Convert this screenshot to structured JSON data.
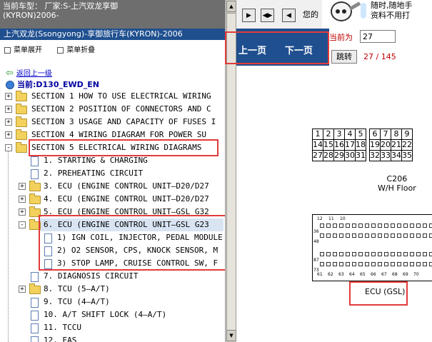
{
  "header": {
    "vehicle_label": "当前车型：",
    "vehicle_maker": "厂家:S-上汽双龙享御",
    "vehicle_code": "(KYRON)2006-",
    "subtitle": "上汽双龙(Ssongyong)-享御旅行车(KYRON)-2006"
  },
  "menu_controls": {
    "expand": "菜单展开",
    "collapse": "菜单折叠"
  },
  "back_link": "返回上一级",
  "current_node": "当前:D130_EWD_EN",
  "tree": [
    {
      "label": "SECTION 1 HOW TO USE ELECTRICAL WIRING",
      "kind": "folder",
      "pm": "+"
    },
    {
      "label": "SECTION 2 POSITION OF CONNECTORS AND C",
      "kind": "folder",
      "pm": "+"
    },
    {
      "label": "SECTION 3 USAGE AND CAPACITY OF FUSES I",
      "kind": "folder",
      "pm": "+"
    },
    {
      "label": "SECTION 4 WIRING DIAGRAM FOR POWER SU",
      "kind": "folder",
      "pm": "+"
    },
    {
      "label": "SECTION 5 ELECTRICAL WIRING DIAGRAMS",
      "kind": "folder",
      "pm": "-"
    },
    {
      "label": "1. STARTING & CHARGING",
      "kind": "doc"
    },
    {
      "label": "2. PREHEATING CIRCUIT",
      "kind": "doc"
    },
    {
      "label": "3. ECU (ENGINE CONTROL UNIT—D20/D27",
      "kind": "folder",
      "pm": "+"
    },
    {
      "label": "4. ECU (ENGINE CONTROL UNIT—D20/D27",
      "kind": "folder",
      "pm": "+"
    },
    {
      "label": "5. ECU (ENGINE CONTROL UNIT—GSL G32",
      "kind": "folder",
      "pm": "+"
    },
    {
      "label": "6. ECU (ENGINE CONTROL UNIT—GSL G23",
      "kind": "folder",
      "pm": "-"
    },
    {
      "label": "1) IGN COIL, INJECTOR, PEDAL MODULE",
      "kind": "doc"
    },
    {
      "label": "2) O2 SENSOR, CPS, KNOCK SENSOR, M",
      "kind": "doc"
    },
    {
      "label": "3) STOP LAMP, CRUISE CONTROL SW, F",
      "kind": "doc"
    },
    {
      "label": "7. DIAGNOSIS CIRCUIT",
      "kind": "doc"
    },
    {
      "label": "8. TCU (5—A/T)",
      "kind": "folder",
      "pm": "+"
    },
    {
      "label": "9. TCU (4—A/T)",
      "kind": "doc"
    },
    {
      "label": "10. A/T SHIFT LOCK (4—A/T)",
      "kind": "doc"
    },
    {
      "label": "11. TCCU",
      "kind": "doc"
    },
    {
      "label": "12. EAS",
      "kind": "doc"
    }
  ],
  "toolbar": {
    "text": "您的",
    "promo_line1": "随时,随地手",
    "promo_line2": "资料不用打"
  },
  "nav": {
    "prev": "上一页",
    "next": "下一页"
  },
  "pager": {
    "current_label": "当前为",
    "page_value": "27",
    "go_label": "跳转",
    "page_count": "27 / 145"
  },
  "diagram": {
    "connector_rows": [
      [
        "1",
        "2",
        "3",
        "4",
        "5",
        "",
        "6",
        "7",
        "8",
        "9"
      ],
      [
        "14",
        "15",
        "16",
        "17",
        "18",
        "",
        "19",
        "20",
        "21",
        "22"
      ],
      [
        "27",
        "28",
        "29",
        "30",
        "31",
        "",
        "32",
        "33",
        "34",
        "35"
      ]
    ],
    "connector_name": "C206",
    "connector_location": "W/H Floor",
    "ecu_pins_top": [
      "12",
      "11",
      "10"
    ],
    "ecu_pins_side": [
      "36",
      "48",
      "87",
      "73"
    ],
    "ecu_pins_bottom": [
      "61",
      "62",
      "63",
      "64",
      "65",
      "66",
      "67",
      "68",
      "69",
      "70"
    ],
    "ecu_label": "ECU (GSL)"
  }
}
